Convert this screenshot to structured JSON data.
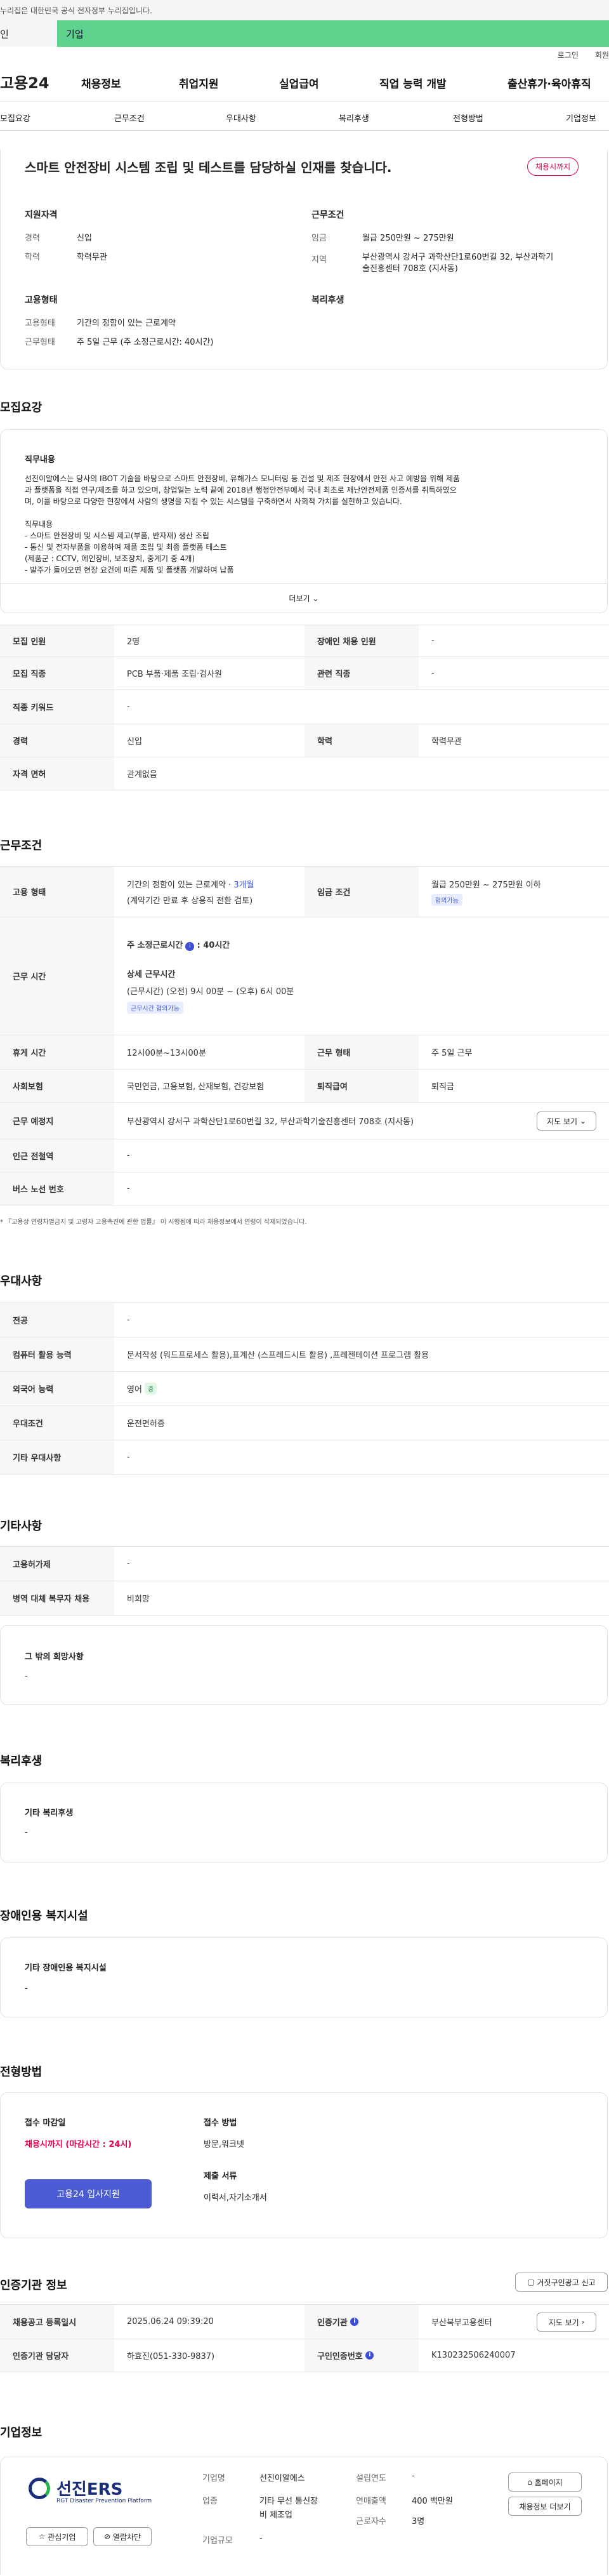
{
  "gov": {
    "notice": "누리집은 대한민국 공식 전자정부 누리집입니다."
  },
  "tabs": {
    "t1": "인",
    "t2": "기업"
  },
  "util": {
    "login": "로그인",
    "join": "회원"
  },
  "gnb": {
    "logo": "고용24",
    "m1": "채용정보",
    "m2": "취업지원",
    "m3": "실업급여",
    "m4": "직업 능력 개발",
    "m5": "출산휴가·육아휴직"
  },
  "anchor": [
    "모집요강",
    "근무조건",
    "우대사항",
    "복리후생",
    "전형방법",
    "기업정보"
  ],
  "summary": {
    "title": "스마트 안전장비 시스템 조립 및 테스트를 담당하실 인재를 찾습니다.",
    "badge": "채용시까지",
    "qual_title": "지원자격",
    "career_k": "경력",
    "career_v": "신입",
    "edu_k": "학력",
    "edu_v": "학력무관",
    "cond_title": "근무조건",
    "pay_k": "임금",
    "pay_v": "월급 250만원 ~ 275만원",
    "loc_k": "지역",
    "loc_v1": "부산광역시 강서구 과학산단1로60번길 32, 부산과학기",
    "loc_v2": "술진흥센터 708호 (지사동)",
    "emp_title": "고용형태",
    "type_k": "고용형태",
    "type_v": "기간의 정함이 있는 근로계약",
    "hours_k": "근무형태",
    "hours_v": "주 5일 근무 (주 소정근로시간: 40시간)",
    "welfare_title": "복리후생"
  },
  "recruit": {
    "sec": "모집요강",
    "duty_title": "직무내용",
    "p1": "선진이알에스는 당사의 IBOT 기술을 바탕으로 스마트 안전장비, 유해가스 모니터링 등 건설 및 제조 현장에서 안전 사고 예방을 위해 제품",
    "p2": "과 플랫폼을 직접 연구/제조를 하고 있으며, 창업일는 노력 끝에 2018년 행정안전부에서 국내 최초로 재난안전제품 인증서를 취득하였으",
    "p3": "며, 이를 바탕으로 다양한 현장에서 사람의 생명을 지킬 수 있는 시스템을 구축하면서 사회적 가치를 실현하고 있습니다.",
    "l0": "직무내용",
    "l1": "- 스마트 안전장비 및 시스템 제고(부품, 반자재) 생산 조립",
    "l2": "- 통신 및 전자부품을 이용하여 제품 조립 및 최종 플랫폼 테스트",
    "l3": "(제품군 : CCTV, 에인장비, 보조장치, 중계기 중 4개)",
    "l4": "- 발주가 들어오면 현장 요건에 따른 제품 및 플랫폼 개발하여 납품",
    "more": "더보기"
  },
  "rtable": [
    {
      "k1": "모집 인원",
      "v1": "2명",
      "k2": "장애인 채용 인원",
      "v2": "-"
    },
    {
      "k1": "모집 직종",
      "v1": "PCB 부품·제품 조립·검사원",
      "k2": "관련 직종",
      "v2": "-"
    },
    {
      "k1": "직종 키워드",
      "v1": "-",
      "k2": "",
      "v2": ""
    },
    {
      "k1": "경력",
      "v1": "신입",
      "k2": "학력",
      "v2": "학력무관"
    },
    {
      "k1": "자격 면허",
      "v1": "관계없음",
      "k2": "",
      "v2": ""
    }
  ],
  "work": {
    "sec": "근무조건",
    "emp_k": "고용 형태",
    "emp_v1": "기간의 정함이 있는 근로계약 · ",
    "emp_v1b": "3개월",
    "emp_v2": "(계약기간 만료 후 상용직 전환 검토)",
    "pay_k": "임금 조건",
    "pay_v": "월급 250만원 ~ 275만원 이하",
    "pay_badge": "협의가능",
    "time_k": "근무 시간",
    "time_a": "주 소정근로시간",
    "time_b": ": 40시간",
    "time_c": "상세 근무시간",
    "time_d": "(근무시간) (오전) 9시 00분 ~ (오후) 6시 00분",
    "time_badge": "근무시간 협의가능",
    "rest_k": "휴게 시간",
    "rest_v": "12시00분~13시00분",
    "form_k": "근무 형태",
    "form_v": "주 5일 근무",
    "ins_k": "사회보험",
    "ins_v": "국민연금, 고용보험, 산재보험, 건강보험",
    "ret_k": "퇴직급여",
    "ret_v": "퇴직금",
    "addr_k": "근무 예정지",
    "addr_v": "부산광역시 강서구 과학산단1로60번길 32, 부산과학기술진흥센터 708호 (지사동)",
    "map": "지도 보기",
    "sta_k": "인근 전철역",
    "sta_v": "-",
    "bus_k": "버스 노선 번호",
    "bus_v": "-",
    "note": "* 『고용상 연령차별금지 및 고령자 고용촉진에 관한 법률』 이 시행됨에 따라 채용정보에서 연령이 삭제되었습니다."
  },
  "pref": {
    "sec": "우대사항",
    "rows": [
      {
        "k": "전공",
        "v": "-"
      },
      {
        "k": "컴퓨터 활용 능력",
        "v": "문서작성 (워드프로세스 활용),표계산 (스프레드시트 활용) ,프레젠테이션 프로그램 활용"
      },
      {
        "k": "외국어 능력",
        "v": "영어",
        "b": "중"
      },
      {
        "k": "우대조건",
        "v": "운전면허증"
      },
      {
        "k": "기타 우대사항",
        "v": "-"
      }
    ]
  },
  "etc": {
    "sec": "기타사항",
    "r1k": "고용허가제",
    "r1v": "-",
    "r2k": "병역 대체 복무자 채용",
    "r2v": "비희망",
    "box_t": "그 밖의 회망사항",
    "box_v": "-"
  },
  "wel": {
    "sec": "복리후생",
    "box_t": "기타 복리후생",
    "box_v": "-"
  },
  "dis": {
    "sec": "장애인용 복지시설",
    "box_t": "기타 장애인용 복지시설",
    "box_v": "-"
  },
  "sel": {
    "sec": "전형방법",
    "dl_t": "접수 마감일",
    "dl_v": "채용시까지 (마감시간 : 24시)",
    "btn": "고용24 입사지원",
    "m_t": "접수 방법",
    "m_v": "방문,워크넷",
    "doc_t": "제출 서류",
    "doc_v": "이력서,자기소개서"
  },
  "cert": {
    "sec": "인증기관 정보",
    "report": "거짓구인광고 신고",
    "r1k": "채용공고 등록일시",
    "r1v": "2025.06.24 09:39:20",
    "r1k2": "인증기관",
    "r1v2": "부산북부고용센터",
    "map": "지도 보기",
    "r2k": "인증기관 담당자",
    "r2v": "하효진(051-330-9837)",
    "r2k2": "구인인증번호",
    "r2v2": "K130232506240007"
  },
  "corp": {
    "sec": "기업정보",
    "name_ko": "선진ERS",
    "name_en": "RGT Disaster Prevention Platform",
    "fav": "관심기업",
    "block": "열람차단",
    "k1": "기업명",
    "v1": "선진이알에스",
    "k2": "업종",
    "v2a": "기타 무선 통신장",
    "v2b": "비 제조업",
    "k3": "기업규모",
    "v3": "-",
    "k4": "설립연도",
    "v4": "-",
    "k5": "연매출액",
    "v5": "400 백만원",
    "k6": "근로자수",
    "v6": "3명",
    "home": "홈페이지",
    "other": "채용정보 더보기"
  },
  "colors": {
    "accent": "#3b4fd8",
    "green": "#5fd38d",
    "red": "#e6004d"
  }
}
